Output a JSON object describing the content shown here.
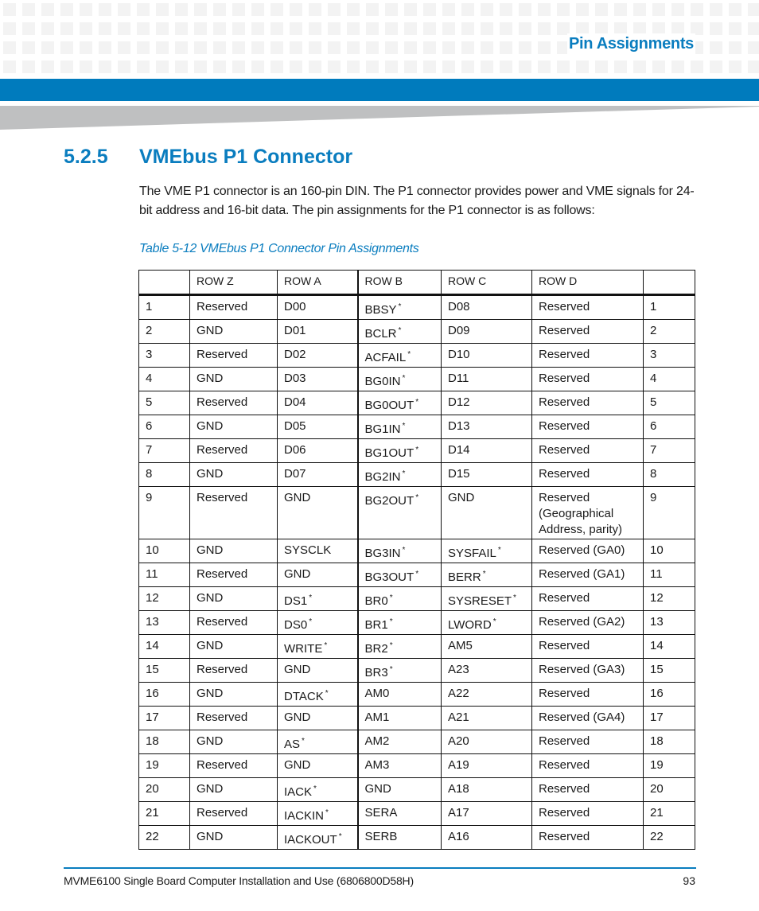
{
  "header": {
    "running_title": "Pin Assignments",
    "colors": {
      "accent_blue": "#007bbd",
      "title_blue": "#0a7dbf",
      "wedge_gray": "#bfc0c1",
      "grid_gray": "#f3f3f3"
    }
  },
  "section": {
    "number": "5.2.5",
    "title": "VMEbus P1 Connector",
    "intro": "The VME P1 connector is an 160-pin DIN. The P1 connector provides power and VME signals for 24-bit address and 16-bit data. The pin assignments for the P1 connector is as follows:"
  },
  "table": {
    "caption": "Table 5-12 VMEbus P1 Connector Pin Assignments",
    "headers": [
      "",
      "ROW Z",
      "ROW A",
      "ROW B",
      "ROW C",
      "ROW D",
      ""
    ],
    "active_low_marker": "*",
    "rows": [
      [
        "1",
        "Reserved",
        "D00",
        "BBSY*",
        "D08",
        "Reserved",
        "1"
      ],
      [
        "2",
        "GND",
        "D01",
        "BCLR*",
        "D09",
        "Reserved",
        "2"
      ],
      [
        "3",
        "Reserved",
        "D02",
        "ACFAIL*",
        "D10",
        "Reserved",
        "3"
      ],
      [
        "4",
        "GND",
        "D03",
        "BG0IN*",
        "D11",
        "Reserved",
        "4"
      ],
      [
        "5",
        "Reserved",
        "D04",
        "BG0OUT*",
        "D12",
        "Reserved",
        "5"
      ],
      [
        "6",
        "GND",
        "D05",
        "BG1IN*",
        "D13",
        "Reserved",
        "6"
      ],
      [
        "7",
        "Reserved",
        "D06",
        "BG1OUT*",
        "D14",
        "Reserved",
        "7"
      ],
      [
        "8",
        "GND",
        "D07",
        "BG2IN*",
        "D15",
        "Reserved",
        "8"
      ],
      [
        "9",
        "Reserved",
        "GND",
        "BG2OUT*",
        "GND",
        "Reserved (Geographical Address, parity)",
        "9"
      ],
      [
        "10",
        "GND",
        "SYSCLK",
        "BG3IN*",
        "SYSFAIL*",
        "Reserved (GA0)",
        "10"
      ],
      [
        "11",
        "Reserved",
        "GND",
        "BG3OUT*",
        "BERR*",
        "Reserved (GA1)",
        "11"
      ],
      [
        "12",
        "GND",
        "DS1*",
        "BR0*",
        "SYSRESET*",
        "Reserved",
        "12"
      ],
      [
        "13",
        "Reserved",
        "DS0*",
        "BR1*",
        "LWORD*",
        "Reserved (GA2)",
        "13"
      ],
      [
        "14",
        "GND",
        "WRITE*",
        "BR2*",
        "AM5",
        "Reserved",
        "14"
      ],
      [
        "15",
        "Reserved",
        "GND",
        "BR3*",
        "A23",
        "Reserved (GA3)",
        "15"
      ],
      [
        "16",
        "GND",
        "DTACK*",
        "AM0",
        "A22",
        "Reserved",
        "16"
      ],
      [
        "17",
        "Reserved",
        "GND",
        "AM1",
        "A21",
        "Reserved (GA4)",
        "17"
      ],
      [
        "18",
        "GND",
        "AS*",
        "AM2",
        "A20",
        "Reserved",
        "18"
      ],
      [
        "19",
        "Reserved",
        "GND",
        "AM3",
        "A19",
        "Reserved",
        "19"
      ],
      [
        "20",
        "GND",
        "IACK*",
        "GND",
        "A18",
        "Reserved",
        "20"
      ],
      [
        "21",
        "Reserved",
        "IACKIN*",
        "SERA",
        "A17",
        "Reserved",
        "21"
      ],
      [
        "22",
        "GND",
        "IACKOUT*",
        "SERB",
        "A16",
        "Reserved",
        "22"
      ]
    ]
  },
  "footer": {
    "document_title": "MVME6100 Single Board Computer Installation and Use (6806800D58H)",
    "page_number": "93"
  }
}
